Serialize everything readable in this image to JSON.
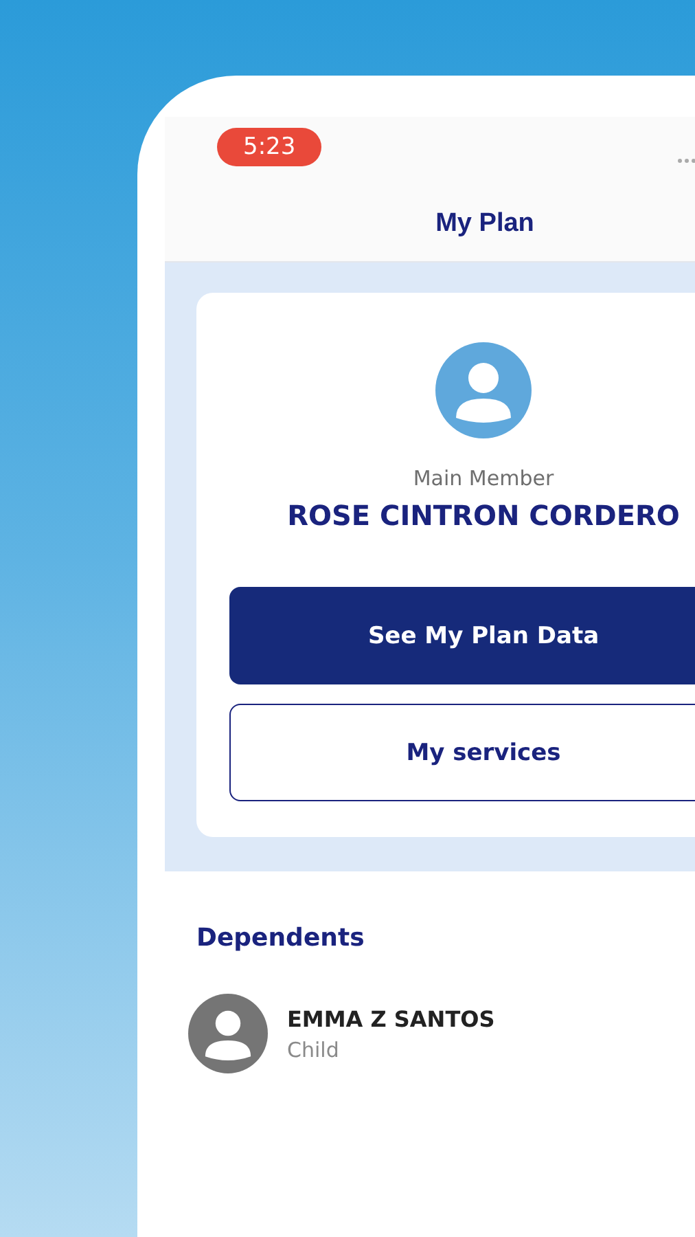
{
  "status_bar": {
    "time": "5:23"
  },
  "header": {
    "title": "My Plan"
  },
  "member": {
    "role": "Main Member",
    "name": "ROSE CINTRON CORDERO"
  },
  "buttons": [
    {
      "label": "See My Plan Data",
      "kind": "primary"
    },
    {
      "label": "My services",
      "kind": "outline"
    }
  ],
  "dependents": {
    "title": "Dependents",
    "items": [
      {
        "name": "EMMA Z SANTOS",
        "relation": "Child"
      }
    ]
  }
}
